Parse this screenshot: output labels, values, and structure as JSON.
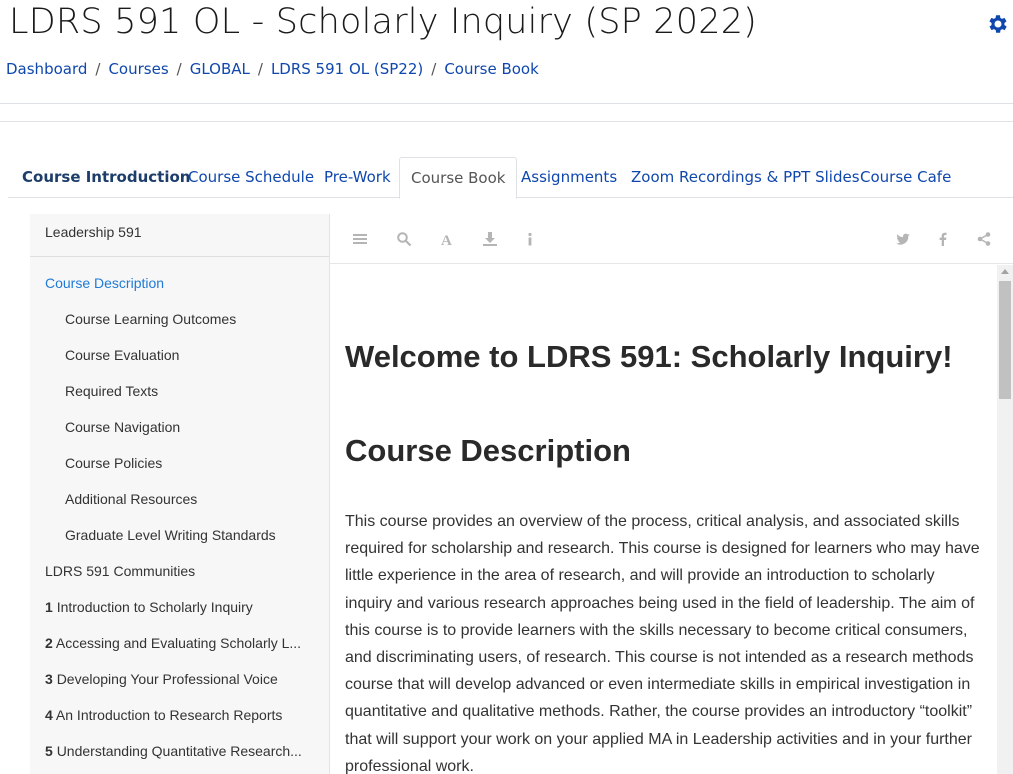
{
  "page": {
    "title": "LDRS 591 OL - Scholarly Inquiry (SP 2022)"
  },
  "breadcrumb": [
    "Dashboard",
    "Courses",
    "GLOBAL",
    "LDRS 591 OL (SP22)",
    "Course Book"
  ],
  "tabs": [
    {
      "label": "Course Introduction",
      "state": "bold"
    },
    {
      "label": "Course Schedule"
    },
    {
      "label": "Pre-Work"
    },
    {
      "label": "Course Book",
      "state": "active"
    },
    {
      "label": "Assignments"
    },
    {
      "label": "Zoom Recordings & PPT Slides"
    },
    {
      "label": "Course Cafe"
    }
  ],
  "sidebar": {
    "heading": "Leadership 591",
    "items": [
      {
        "num": "",
        "label": "Course Description",
        "current": true
      },
      {
        "num": "",
        "label": "Course Learning Outcomes"
      },
      {
        "num": "",
        "label": "Course Evaluation"
      },
      {
        "num": "",
        "label": "Required Texts"
      },
      {
        "num": "",
        "label": "Course Navigation"
      },
      {
        "num": "",
        "label": "Course Policies"
      },
      {
        "num": "",
        "label": "Additional Resources"
      },
      {
        "num": "",
        "label": "Graduate Level Writing Standards"
      },
      {
        "num": "",
        "label": "LDRS 591 Communities"
      },
      {
        "num": "1",
        "label": "Introduction to Scholarly Inquiry"
      },
      {
        "num": "2",
        "label": "Accessing and Evaluating Scholarly L..."
      },
      {
        "num": "3",
        "label": "Developing Your Professional Voice"
      },
      {
        "num": "4",
        "label": "An Introduction to Research Reports"
      },
      {
        "num": "5",
        "label": "Understanding Quantitative Research..."
      }
    ]
  },
  "toolbar": {
    "icons": [
      "list-icon",
      "search-icon",
      "font-icon",
      "download-icon",
      "info-icon",
      "twitter-icon",
      "facebook-icon",
      "share-icon"
    ]
  },
  "content": {
    "heading": "Welcome to LDRS 591: Scholarly Inquiry!",
    "subheading": "Course Description",
    "paragraph": "This course provides an overview of the process, critical analysis, and associated skills required for scholarship and research. This course is designed for learners who may have little experience in the area of research, and will provide an introduction to scholarly inquiry and various research approaches being used in the field of leadership. The aim of this course is to provide learners with the skills necessary to become critical consumers, and discriminating users, of research. This course is not intended as a research methods course that will develop advanced or even intermediate skills in empirical investigation in quantitative and qualitative methods. Rather, the course provides an introductory “toolkit” that will support your work on your applied MA in Leadership activities and in your further professional work."
  },
  "colors": {
    "link": "#0f47ad",
    "current": "#1f7bd6",
    "sidebar_bg": "#f7f7f7"
  }
}
